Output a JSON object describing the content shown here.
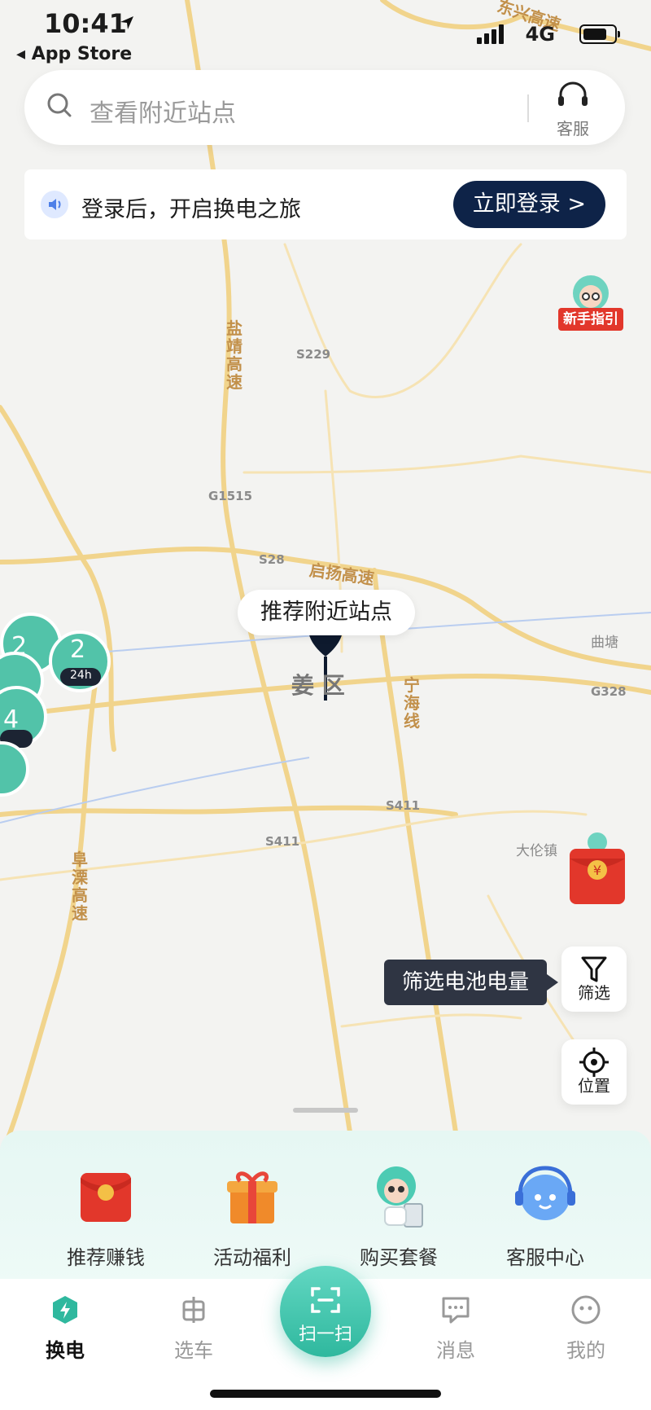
{
  "status_bar": {
    "time": "10:41",
    "back_label": "◂ App Store",
    "network": "4G"
  },
  "search": {
    "placeholder": "查看附近站点",
    "service_label": "客服"
  },
  "banner": {
    "text": "登录后，开启换电之旅",
    "button": "立即登录 >"
  },
  "floating": {
    "guide_label": "新手指引",
    "filter_tip": "筛选电池电量",
    "filter_label": "筛选",
    "locate_label": "位置"
  },
  "map": {
    "bubble": "推荐附近站点",
    "district": "姜   区",
    "road_names": [
      "东兴高速",
      "盐靖高速",
      "启扬高速",
      "宁海线",
      "阜溧高速"
    ],
    "road_codes": [
      "S229",
      "G1515",
      "S28",
      "S411",
      "S411",
      "G328"
    ],
    "places": [
      "曲塘",
      "大伦镇"
    ],
    "station_counts": [
      "2",
      "2",
      "4"
    ],
    "station_badge": "24h"
  },
  "features": [
    {
      "label": "推荐赚钱",
      "icon": "red-envelope-icon"
    },
    {
      "label": "活动福利",
      "icon": "gift-icon"
    },
    {
      "label": "购买套餐",
      "icon": "mascot-icon"
    },
    {
      "label": "客服中心",
      "icon": "headset-bot-icon"
    }
  ],
  "tabs": [
    {
      "label": "换电",
      "icon": "battery-swap-icon",
      "active": true
    },
    {
      "label": "选车",
      "icon": "scooter-icon"
    },
    {
      "label": "扫一扫",
      "icon": "scan-icon"
    },
    {
      "label": "消息",
      "icon": "message-icon"
    },
    {
      "label": "我的",
      "icon": "profile-icon"
    }
  ],
  "colors": {
    "accent": "#2fb89e",
    "navy": "#0e2348",
    "road": "#f1d48c"
  }
}
